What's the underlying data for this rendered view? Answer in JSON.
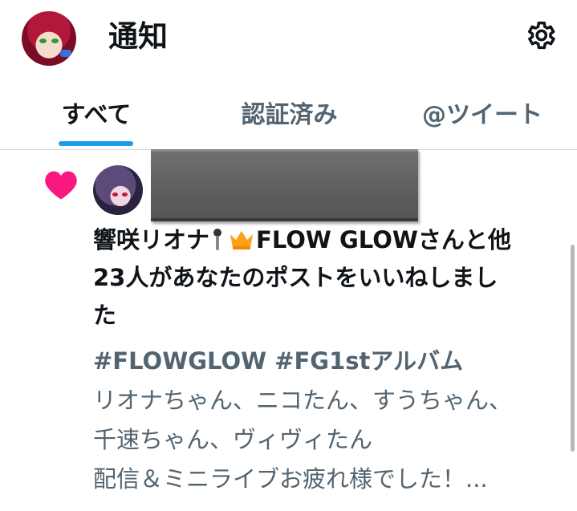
{
  "header": {
    "title": "通知"
  },
  "tabs": [
    {
      "label": "すべて",
      "active": true
    },
    {
      "label": "認証済み",
      "active": false
    },
    {
      "label": "@ツイート",
      "active": false
    }
  ],
  "notification": {
    "liker_name": "響咲リオナ",
    "second_name": "FLOW GLOW",
    "line1_suffix": "さんと他",
    "line2": "23人があなたのポストをいいねしまし",
    "line3": "た",
    "post_lines": [
      "#FLOWGLOW #FG1stアルバム",
      "リオナちゃん、ニコたん、すうちゃん、",
      "千速ちゃん、ヴィヴィたん",
      "配信＆ミニライブお疲れ様でした！..."
    ]
  },
  "colors": {
    "accent": "#1d9bf0",
    "like": "#f91880",
    "secondary_text": "#536471",
    "crown": "#ff9f1a"
  },
  "icons": [
    "gear-icon",
    "heart-icon",
    "microphone-emoji",
    "crown-emoji"
  ]
}
